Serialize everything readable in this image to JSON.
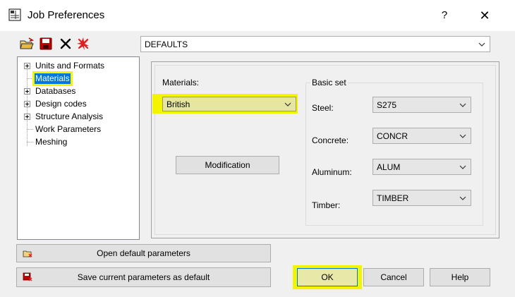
{
  "window": {
    "title": "Job Preferences",
    "help_glyph": "?",
    "close_glyph": "✕"
  },
  "toolbar": {
    "icons": [
      "open-folder-icon",
      "save-icon",
      "delete-icon",
      "reset-icon"
    ]
  },
  "preset_combo": {
    "value": "DEFAULTS"
  },
  "tree": {
    "items": [
      {
        "label": "Units and Formats",
        "expandable": true
      },
      {
        "label": "Materials",
        "expandable": false,
        "selected": true
      },
      {
        "label": "Databases",
        "expandable": true
      },
      {
        "label": "Design codes",
        "expandable": true
      },
      {
        "label": "Structure Analysis",
        "expandable": true
      },
      {
        "label": "Work Parameters",
        "expandable": false
      },
      {
        "label": "Meshing",
        "expandable": false
      }
    ]
  },
  "materials": {
    "label": "Materials:",
    "value": "British",
    "modification_label": "Modification"
  },
  "basic_set": {
    "title": "Basic set",
    "steel": {
      "label": "Steel:",
      "value": "S275"
    },
    "concrete": {
      "label": "Concrete:",
      "value": "CONCR"
    },
    "aluminum": {
      "label": "Aluminum:",
      "value": "ALUM"
    },
    "timber": {
      "label": "Timber:",
      "value": "TIMBER"
    }
  },
  "buttons": {
    "open_default": "Open default parameters",
    "save_default": "Save current parameters as default",
    "ok": "OK",
    "cancel": "Cancel",
    "help": "Help"
  },
  "colors": {
    "highlight": "#f4f400",
    "selection": "#0078d7",
    "accent_red": "#e02020"
  }
}
